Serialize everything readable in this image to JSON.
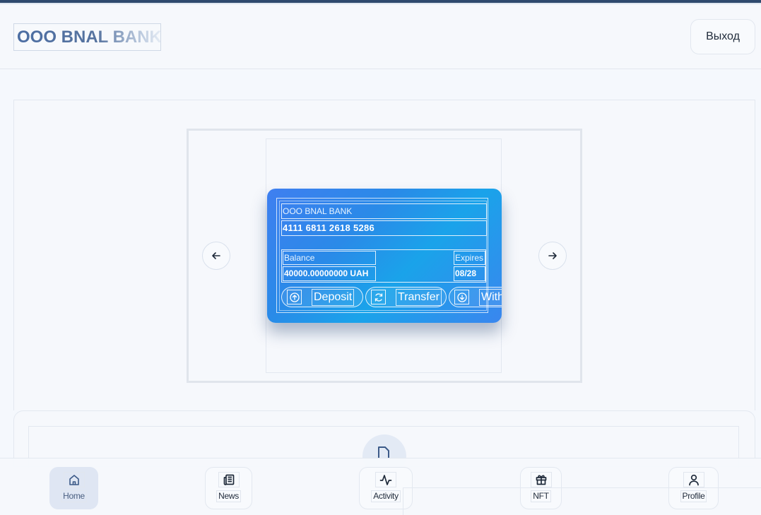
{
  "header": {
    "brand": "OOO BNAL BANK",
    "logout_label": "Выход"
  },
  "card": {
    "bank_name": "OOO BNAL BANK",
    "number": "4111 6811 2618 5286",
    "balance_label": "Balance",
    "balance_value": "40000.00000000 UAH",
    "expires_label": "Expires",
    "expires_value": "08/28",
    "actions": [
      {
        "label": "Deposit",
        "icon": "arrow-up-circle-icon"
      },
      {
        "label": "Transfer",
        "icon": "refresh-icon"
      },
      {
        "label": "Withdraw",
        "icon": "arrow-down-circle-icon"
      }
    ]
  },
  "carousel": {
    "prev_icon": "arrow-left-icon",
    "next_icon": "arrow-right-icon"
  },
  "bottom_nav": {
    "items": [
      {
        "label": "Home",
        "icon": "home-icon",
        "active": true
      },
      {
        "label": "News",
        "icon": "newspaper-icon",
        "active": false
      },
      {
        "label": "Activity",
        "icon": "activity-icon",
        "active": false
      },
      {
        "label": "NFT",
        "icon": "gift-icon",
        "active": false
      },
      {
        "label": "Profile",
        "icon": "user-icon",
        "active": false
      }
    ]
  },
  "colors": {
    "accent": "#2f4a6e",
    "card_gradient_start": "#3f7ff0",
    "card_gradient_mid": "#1aa3ea",
    "background": "#f5f8fd"
  }
}
